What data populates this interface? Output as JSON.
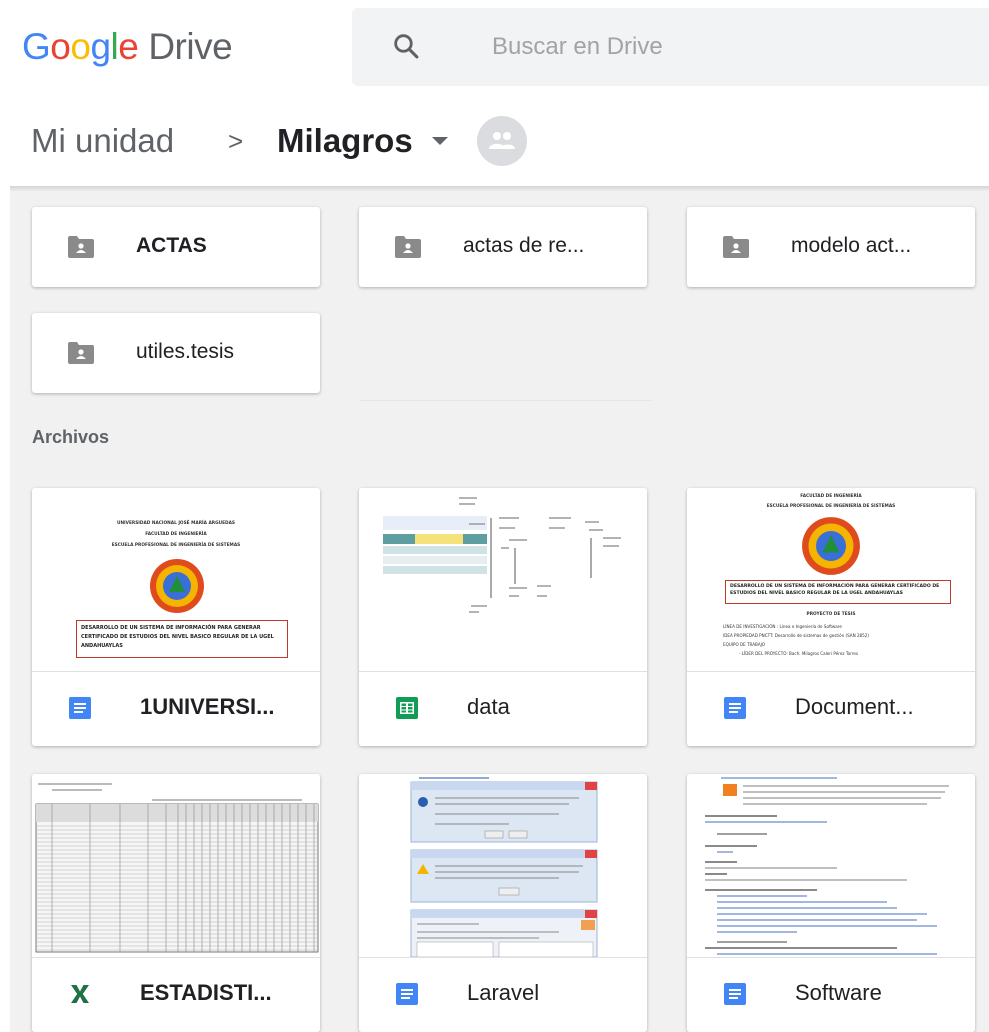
{
  "header": {
    "logo_google": "Google",
    "logo_drive": "Drive",
    "search_placeholder": "Buscar en Drive"
  },
  "breadcrumb": {
    "root": "Mi unidad",
    "separator": ">",
    "current": "Milagros"
  },
  "folders": [
    {
      "name": "ACTAS"
    },
    {
      "name": "actas de re..."
    },
    {
      "name": "modelo act..."
    },
    {
      "name": "utiles.tesis"
    }
  ],
  "files_section": {
    "label": "Archivos"
  },
  "files": [
    {
      "name": "1UNIVERSI...",
      "type_icon": "google-docs-icon"
    },
    {
      "name": "data",
      "type_icon": "google-sheets-icon"
    },
    {
      "name": "Document...",
      "type_icon": "google-docs-icon"
    },
    {
      "name": "ESTADISTI...",
      "type_icon": "excel-icon"
    },
    {
      "name": "Laravel",
      "type_icon": "google-docs-icon"
    },
    {
      "name": "Software",
      "type_icon": "google-docs-icon"
    }
  ],
  "thumbnails": {
    "doc1": {
      "line1": "UNIVERSIDAD NACIONAL JOSÉ MARÍA ARGUEDAS",
      "line2": "FACULTAD DE INGENIERÍA",
      "line3": "ESCUELA PROFESIONAL DE INGENIERÍA DE SISTEMAS",
      "title": "DESARROLLO DE UN SISTEMA DE INFORMACIÓN PARA GENERAR CERTIFICADO DE ESTUDIOS DEL NIVEL BASICO REGULAR DE LA UGEL ANDAHUAYLAS"
    },
    "doc3": {
      "line1": "FACULTAD DE INGENIERÍA",
      "line2": "ESCUELA PROFESIONAL DE INGENIERÍA DE SISTEMAS",
      "title": "DESARROLLO DE UN SISTEMA DE INFORMACIÓN PARA GENERAR CERTIFICADO DE ESTUDIOS DEL NIVEL BASICO REGULAR DE LA UGEL ANDAHUAYLAS",
      "subtitle": "PROYECTO DE TESIS",
      "items": [
        "LÍNEA DE INVESTIGACIÓN : Línea e Ingeniería de Software",
        "IDEA PROPIEDAD PNCTT: Desarrollo de sistemas de gestión (SAN 2852)",
        "EQUIPO DE TRABAJO",
        "- LÍDER DEL PROYECTO: Bach. Milagros Caleri Pérez Torres"
      ]
    }
  },
  "colors": {
    "docs_blue": "#4285f4",
    "sheets_green": "#0f9d58",
    "excel_green": "#1e7145",
    "folder_grey": "#8a8a8a",
    "background_grey": "#f1f1f1"
  }
}
